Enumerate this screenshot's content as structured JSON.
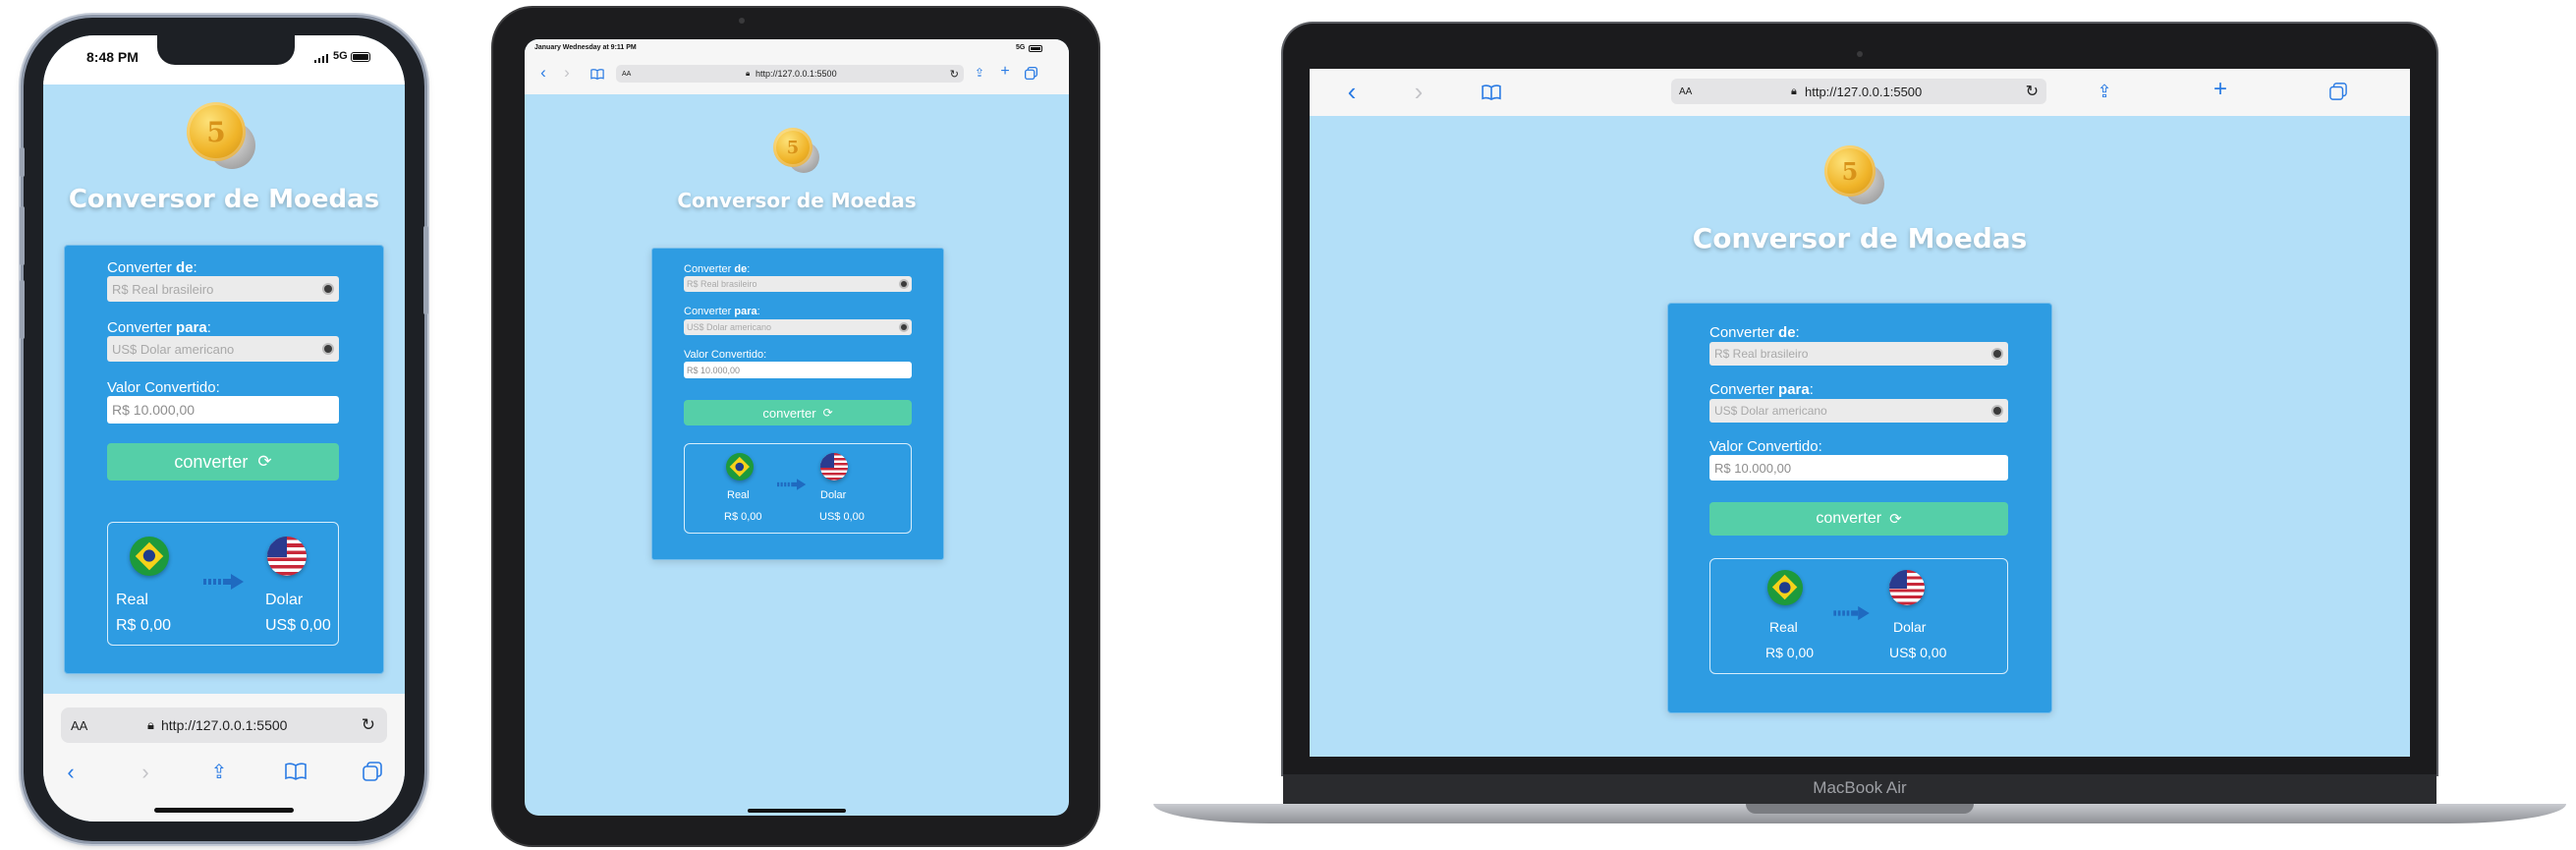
{
  "app": {
    "title": "Conversor de Moedas",
    "from_label_prefix": "Converter ",
    "from_label_bold": "de",
    "from_label_suffix": ":",
    "from_value": "R$ Real brasileiro",
    "to_label_prefix": "Converter ",
    "to_label_bold": "para",
    "to_label_suffix": ":",
    "to_value": "US$ Dolar americano",
    "converted_label": "Valor Convertido:",
    "converted_value": "R$ 10.000,00",
    "convert_button": "converter",
    "from_currency_name": "Real",
    "from_currency_amount": "R$ 0,00",
    "to_currency_name": "Dolar",
    "to_currency_amount": "US$ 0,00",
    "coin_symbol": "5"
  },
  "browser": {
    "url": "http://127.0.0.1:5500",
    "text_size_label": "AA",
    "text_size_label_small": "AA"
  },
  "phone": {
    "time": "8:48 PM",
    "network": "5G"
  },
  "tablet": {
    "status_left": "January Wednesday at 9:11 PM",
    "network": "5G"
  },
  "laptop": {
    "model_label": "MacBook Air"
  },
  "colors": {
    "page_bg": "#b3dff8",
    "card_bg": "#2e9ce2",
    "button": "#55cfa8",
    "accent_icon": "#2a7be4"
  },
  "icons": [
    "lock-icon",
    "reload-icon",
    "share-icon",
    "book-icon",
    "tabs-icon",
    "plus-icon",
    "back-icon",
    "forward-icon",
    "sync-icon",
    "arrow-right-icon",
    "coin-icon"
  ]
}
